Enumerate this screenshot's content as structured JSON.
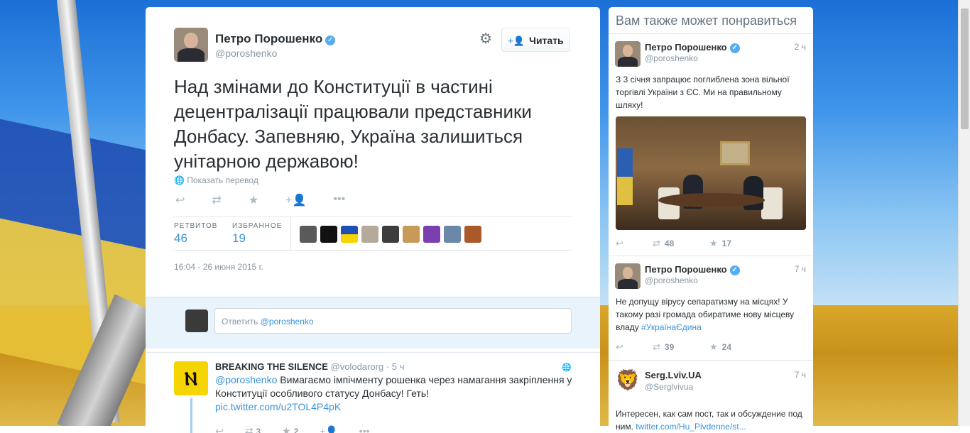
{
  "main_tweet": {
    "author_name": "Петро Порошенко",
    "author_handle": "@poroshenko",
    "follow_label": "Читать",
    "text": "Над змінами до Конституції в частині децентралізації працювали представники Донбасу. Запевняю, Україна залишиться унітарною державою!",
    "translate_label": "Показать перевод",
    "stats": {
      "retweets_label": "РЕТВИТОВ",
      "retweets": "46",
      "favorites_label": "ИЗБРАННОЕ",
      "favorites": "19"
    },
    "timestamp": "16:04 - 26 июня 2015 г.",
    "icons": [
      "reply-icon",
      "retweet-icon",
      "favorite-icon",
      "follow-icon",
      "more-icon",
      "gear-icon",
      "verified-icon",
      "globe-icon"
    ]
  },
  "reply_box": {
    "prefix": "Ответить",
    "mention": "@poroshenko"
  },
  "reply_tweet": {
    "author_name": "BREAKING THE SILENCE",
    "author_handle": "@volodarorg",
    "time": "· 5 ч",
    "mention": "@poroshenko",
    "text": " Вимагаємо імпічменту рошенка через намагання закріплення у Конституції особливого статусу Донбасу! Геть!",
    "link": "pic.twitter.com/u2TOL4P4pK",
    "retweets": "3",
    "favorites": "2"
  },
  "sidebar": {
    "title": "Вам также может понравиться",
    "items": [
      {
        "name": "Петро Порошенко",
        "handle": "@poroshenko",
        "time": "2 ч",
        "text": "З 3 січня запрацює поглиблена зона вільної торгівлі України з ЄС. Ми на правильному шляху!",
        "retweets": "48",
        "favorites": "17"
      },
      {
        "name": "Петро Порошенко",
        "handle": "@poroshenko",
        "time": "7 ч",
        "text": "Не допущу вірусу сепаратизму на місцях! У такому разі громада обиратиме нову місцеву владу ",
        "hashtag": "#УкраїнаЄдина",
        "retweets": "39",
        "favorites": "24"
      },
      {
        "name": "Serg.Lviv.UA",
        "handle": "@Serglvivua",
        "time": "7 ч",
        "text": "Интересен, как сам пост, так и обсуждение под ним. ",
        "link": "twitter.com/Hu_Pivdenne/st..."
      }
    ]
  },
  "colors": {
    "link": "#3b94d9",
    "verified": "#55acee",
    "muted": "#8899a6"
  }
}
